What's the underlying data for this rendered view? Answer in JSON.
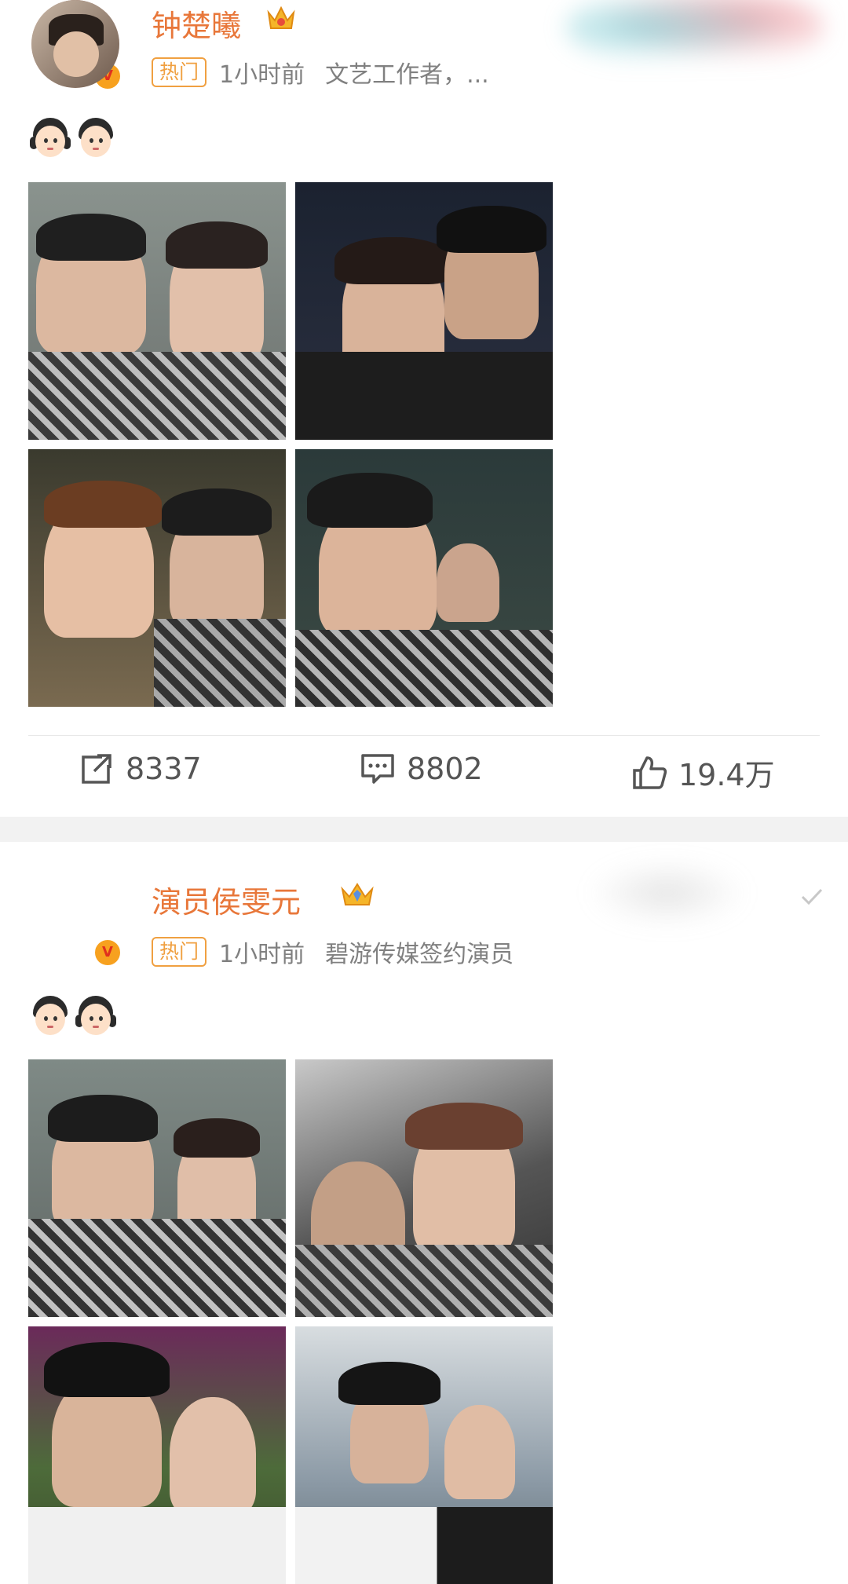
{
  "posts": [
    {
      "author": "钟楚曦",
      "hot_label": "热门",
      "time": "1小时前",
      "description": "文艺工作者，...",
      "verified_mark": "V",
      "emojis": [
        "girl-emoji",
        "boy-emoji"
      ],
      "photos": 4,
      "actions": {
        "repost_count": "8337",
        "comment_count": "8802",
        "like_count": "19.4万"
      }
    },
    {
      "author": "演员侯雯元",
      "hot_label": "热门",
      "time": "1小时前",
      "description": "碧游传媒签约演员",
      "verified_mark": "V",
      "emojis": [
        "boy-emoji",
        "girl-emoji"
      ],
      "photos": 4
    }
  ],
  "colors": {
    "name": "#e8773a",
    "hot": "#f0a041",
    "badge": "#f7a11f",
    "meta": "#808080"
  },
  "icons": [
    "share-icon",
    "comment-icon",
    "like-icon",
    "crown-icon",
    "check-icon"
  ]
}
